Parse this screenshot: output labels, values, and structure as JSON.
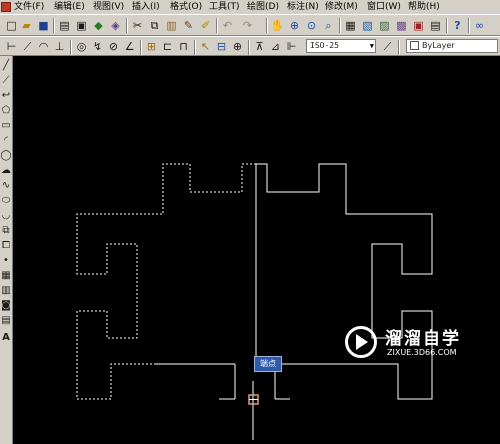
{
  "menu": {
    "items": [
      "文件(F)",
      "编辑(E)",
      "视图(V)",
      "插入(I)",
      "格式(O)",
      "工具(T)",
      "绘图(D)",
      "标注(N)",
      "修改(M)",
      "窗口(W)",
      "帮助(H)"
    ]
  },
  "toolbar_standard": {
    "icons": [
      "new-file-icon",
      "open-file-icon",
      "save-icon",
      "print-icon",
      "print-preview-icon",
      "publish-icon",
      "plot-icon",
      "cut-icon",
      "copy-icon",
      "paste-icon",
      "brush-icon",
      "match-properties-icon",
      "undo-icon",
      "redo-icon",
      "pan-icon",
      "zoom-realtime-icon",
      "zoom-window-icon",
      "zoom-previous-icon",
      "properties-icon",
      "design-center-icon",
      "tool-palette-icon",
      "sheet-set-icon",
      "markup-icon",
      "calculator-icon",
      "help-icon",
      "orbit-icon"
    ]
  },
  "toolbar_dimension": {
    "icons": [
      "linear-dimension-icon",
      "aligned-dimension-icon",
      "arc-length-icon",
      "ordinate-icon",
      "radius-icon",
      "jogged-icon",
      "diameter-icon",
      "angular-icon",
      "quick-dimension-icon",
      "baseline-icon",
      "continue-icon",
      "quick-leader-icon",
      "tolerance-icon",
      "center-mark-icon",
      "dimension-edit-icon",
      "dimension-text-edit-icon",
      "dimension-update-icon"
    ],
    "dimstyle_value": "ISO-25",
    "dimstyle_apply_icon": "dimstyle-apply-icon",
    "layer_value": "ByLayer"
  },
  "draw_toolbar": {
    "icons": [
      "line-icon",
      "construction-line-icon",
      "polyline-icon",
      "polygon-icon",
      "rectangle-icon",
      "arc-icon",
      "circle-icon",
      "revision-cloud-icon",
      "spline-icon",
      "ellipse-icon",
      "ellipse-arc-icon",
      "insert-block-icon",
      "make-block-icon",
      "point-icon",
      "hatch-icon",
      "gradient-icon",
      "region-icon",
      "table-icon",
      "multiline-text-icon"
    ],
    "text_tool_label": "A"
  },
  "drawing": {
    "snap_marker_icon": "endpoint-snap-marker-icon",
    "snap_tooltip": "端点",
    "colors": {
      "background": "#000000",
      "geometry": "#ffffff",
      "snap_marker": "#e0a070"
    }
  },
  "watermark": {
    "logo_icon": "play-circle-logo-icon",
    "title": "溜溜自学",
    "subtitle": "ZIXUE.3D66.COM"
  }
}
